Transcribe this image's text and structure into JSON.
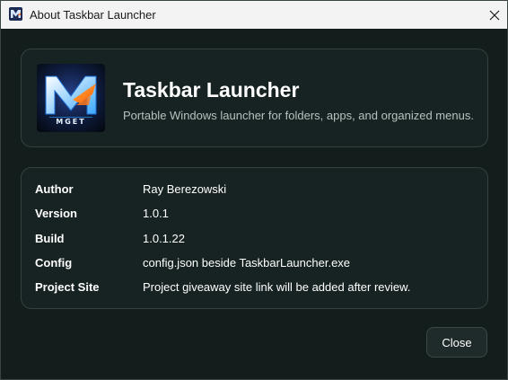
{
  "window": {
    "title": "About Taskbar Launcher"
  },
  "header": {
    "app_name": "Taskbar Launcher",
    "description": "Portable Windows launcher for folders, apps, and organized menus.",
    "logo_text": "MGET"
  },
  "info": {
    "rows": [
      {
        "label": "Author",
        "value": "Ray Berezowski"
      },
      {
        "label": "Version",
        "value": "1.0.1"
      },
      {
        "label": "Build",
        "value": "1.0.1.22"
      },
      {
        "label": "Config",
        "value": "config.json beside TaskbarLauncher.exe"
      },
      {
        "label": "Project Site",
        "value": "Project giveaway site link will be added after review."
      }
    ]
  },
  "footer": {
    "close_label": "Close"
  },
  "colors": {
    "window_bg": "#131d1c",
    "card_bg": "#172322",
    "accent_blue": "#3aa8ff",
    "accent_orange": "#ff7a1a"
  }
}
